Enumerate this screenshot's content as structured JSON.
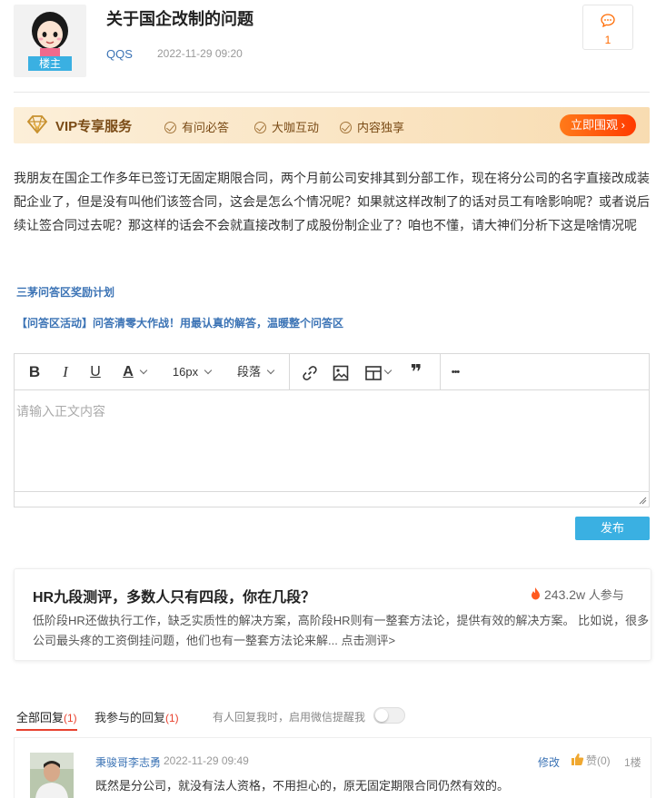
{
  "post": {
    "title": "关于国企改制的问题",
    "owner_tag": "楼主",
    "author": "QQS",
    "date": "2022-11-29 09:20",
    "comment_count": "1",
    "body": "我朋友在国企工作多年已签订无固定期限合同，两个月前公司安排其到分部工作，现在将分公司的名字直接改成装配企业了，但是没有叫他们该签合同，这会是怎么个情况呢？如果就这样改制了的话对员工有啥影响呢？或者说后续让签合同过去呢？那这样的话会不会就直接改制了成股份制企业了？咱也不懂，请大神们分析下这是啥情况呢"
  },
  "vip": {
    "title": "VIP专享服务",
    "features": [
      "有问必答",
      "大咖互动",
      "内容独享"
    ],
    "cta": "立即围观 ›"
  },
  "links": {
    "reward_plan": "三茅问答区奖励计划",
    "activity": "【问答区活动】问答清零大作战！用最认真的解答，温暖整个问答区"
  },
  "editor": {
    "bold": "B",
    "italic": "I",
    "underline": "U",
    "text_color": "A",
    "font_size": "16px",
    "paragraph": "段落",
    "quote": "❞",
    "more": "•••",
    "placeholder": "请输入正文内容",
    "publish": "发布"
  },
  "hr_card": {
    "title": "HR九段测评，多数人只有四段，你在几段？",
    "stat_value": "243.2w",
    "stat_label": "人参与",
    "description": "低阶段HR还做执行工作，缺乏实质性的解决方案，高阶段HR则有一整套方法论，提供有效的解决方案。 比如说，很多公司最头疼的工资倒挂问题，他们也有一整套方法论来解... 点击测评>"
  },
  "tabs": {
    "all_label": "全部回复",
    "all_count": "(1)",
    "mine_label": "我参与的回复",
    "mine_count": "(1)",
    "notify_text": "有人回复我时，启用微信提醒我"
  },
  "reply": {
    "name": "秉骏哥李志勇",
    "date": "2022-11-29 09:49",
    "edit": "修改",
    "like": "赞(0)",
    "floor": "1楼",
    "text": "既然是分公司，就没有法人资格，不用担心的，原无固定期限合同仍然有效的。"
  },
  "colors": {
    "accent_blue": "#3ab0e2",
    "link_blue": "#3b73b5",
    "orange": "#ff6a00",
    "red_tab": "#e8412e"
  }
}
